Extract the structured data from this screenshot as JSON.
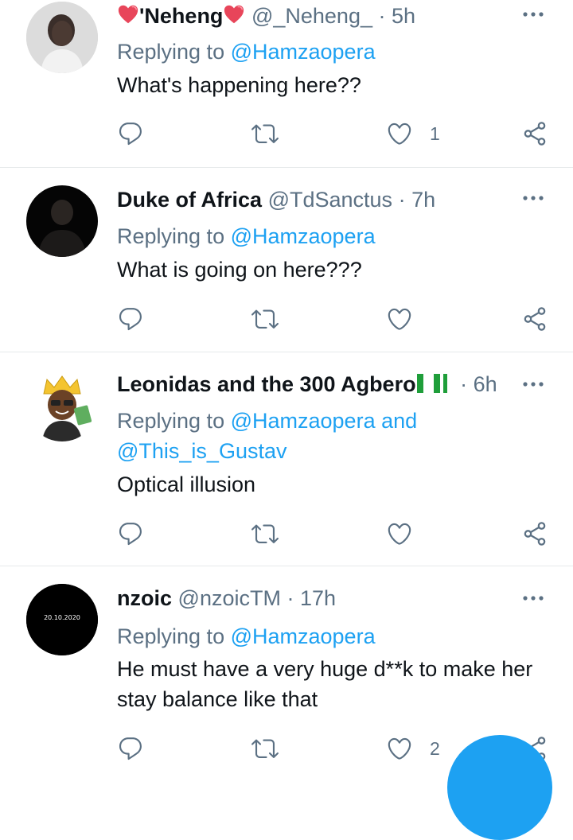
{
  "tweets": [
    {
      "name": "'Neheng",
      "handle": "@_Neheng_",
      "dot": "·",
      "time": "5h",
      "replying_prefix": "Replying to ",
      "replying_to": [
        "@Hamzaopera"
      ],
      "text": "What's happening here??",
      "like_count": "1",
      "avatar": "avatar-woman-photo"
    },
    {
      "name": "Duke of Africa",
      "handle": "@TdSanctus",
      "dot": "·",
      "time": "7h",
      "replying_prefix": "Replying to ",
      "replying_to": [
        "@Hamzaopera"
      ],
      "text": "What is going on here???",
      "like_count": "",
      "avatar": "avatar-dark-photo"
    },
    {
      "name": "Leonidas and the 300 Agbero",
      "handle": "",
      "dot": "·",
      "time": "6h",
      "replying_prefix": "Replying to ",
      "replying_to": [
        "@Hamzaopera",
        "@This_is_Gustav"
      ],
      "replying_joiner": " and",
      "text": "Optical illusion",
      "like_count": "",
      "avatar": "avatar-cartoon-king"
    },
    {
      "name": "nzoic",
      "handle": "@nzoicTM",
      "dot": "·",
      "time": "17h",
      "replying_prefix": "Replying to ",
      "replying_to": [
        "@Hamzaopera"
      ],
      "text": "He must have a very huge d**k to make her stay balance like that",
      "like_count": "2",
      "avatar": "avatar-black-date",
      "avatar_text": "20.10.2020"
    }
  ],
  "colors": {
    "text": "#0f1419",
    "secondary": "#5b7083",
    "link": "#1da1f2",
    "divider": "#e6e9eb",
    "fab": "#1da1f2"
  },
  "icons": [
    "reply-icon",
    "retweet-icon",
    "like-icon",
    "share-icon",
    "more-icon",
    "heart-emoji-icon",
    "nigeria-flag-icon",
    "compose-fab"
  ]
}
